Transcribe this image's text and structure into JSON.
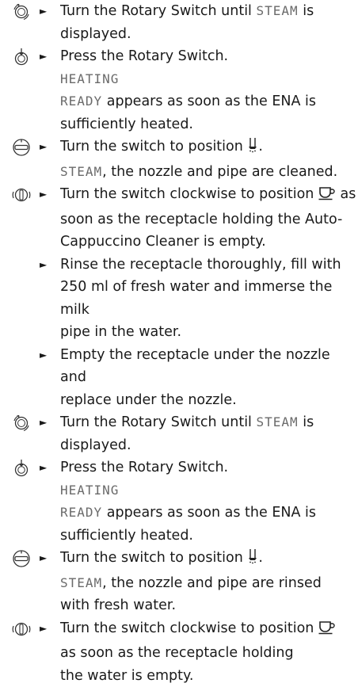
{
  "steps": [
    {
      "icon": "rotary-turn-icon",
      "line1_prefix": "Turn the Rotary Switch until ",
      "line1_lcd": "STEAM",
      "line1_suffix": " is",
      "line2": "displayed."
    },
    {
      "icon": "rotary-press-icon",
      "line1": "Press the Rotary Switch.",
      "lcd1": "HEATING",
      "lcd2": "READY",
      "lcd2_suffix": " appears as soon as the ENA is",
      "line4": "sufficiently heated."
    },
    {
      "icon": "switch-position-icon",
      "line1": "Turn the switch to position ",
      "lcd": "STEAM",
      "line2": ", the nozzle and pipe are cleaned."
    },
    {
      "icon": "switch-clockwise-icon",
      "line1": "Turn the switch clockwise to position ",
      "line1_suffix": " as",
      "line2": "soon as the receptacle holding the Auto-",
      "line3": "Cappuccino Cleaner is empty."
    },
    {
      "line1": "Rinse the receptacle thoroughly, fill with",
      "line2": "250 ml of fresh water and immerse the milk",
      "line3": "pipe in the water."
    },
    {
      "line1": "Empty the receptacle under the nozzle and",
      "line2": "replace under the nozzle."
    },
    {
      "icon": "rotary-turn-icon",
      "line1_prefix": "Turn the Rotary Switch until ",
      "line1_lcd": "STEAM",
      "line1_suffix": " is",
      "line2": "displayed."
    },
    {
      "icon": "rotary-press-icon",
      "line1": "Press the Rotary Switch.",
      "lcd1": "HEATING",
      "lcd2": "READY",
      "lcd2_suffix": " appears as soon as the ENA is",
      "line4": "sufficiently heated."
    },
    {
      "icon": "switch-position-icon",
      "line1": "Turn the switch to position ",
      "lcd": "STEAM",
      "line2": ", the nozzle and pipe are rinsed",
      "line3": "with fresh water."
    },
    {
      "icon": "switch-clockwise-icon",
      "line1": "Turn the switch clockwise to position ",
      "line2": "as soon as the receptacle holding",
      "line3": "the water is empty."
    }
  ],
  "bullet": "►"
}
